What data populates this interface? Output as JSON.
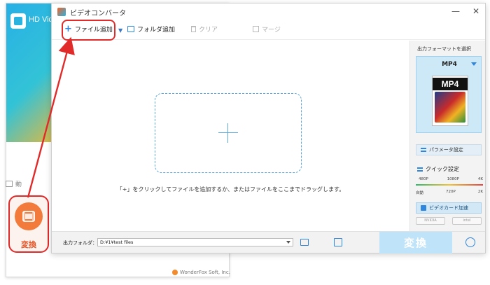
{
  "launcher": {
    "title": "HD Video C",
    "side_item": "動",
    "convert_label": "変換",
    "footer": "WonderFox Soft, Inc."
  },
  "window": {
    "title": "ビデオコンバータ",
    "controls": {
      "minimize": "—",
      "close": "✕"
    }
  },
  "toolbar": {
    "add_file": "ファイル追加",
    "add_folder": "フォルダ追加",
    "clear": "クリア",
    "merge": "マージ"
  },
  "workspace": {
    "hint": "「+」をクリックしてファイルを追加するか、またはファイルをここまでドラッグします。"
  },
  "right_panel": {
    "label": "出力フォーマットを選択",
    "format": "MP4",
    "format_icon_text": "MP4",
    "param_button": "パラメータ設定",
    "quick_label": "クイック設定",
    "resolutions_top": [
      "480P",
      "1080P",
      "4K"
    ],
    "resolutions_bottom": [
      "自動",
      "720P",
      "2K"
    ],
    "gpu_button": "ビデオカード加速",
    "gpu_brands": [
      "NVIDIA",
      "intel"
    ]
  },
  "bottom": {
    "output_label": "出力フォルダ：",
    "output_path": "D:¥1¥test files",
    "convert_button": "変換"
  },
  "colors": {
    "accent_blue": "#2e86de",
    "highlight_red": "#e12a2a",
    "convert_orange": "#f27a3a",
    "format_card_bg": "#cde9f8"
  }
}
